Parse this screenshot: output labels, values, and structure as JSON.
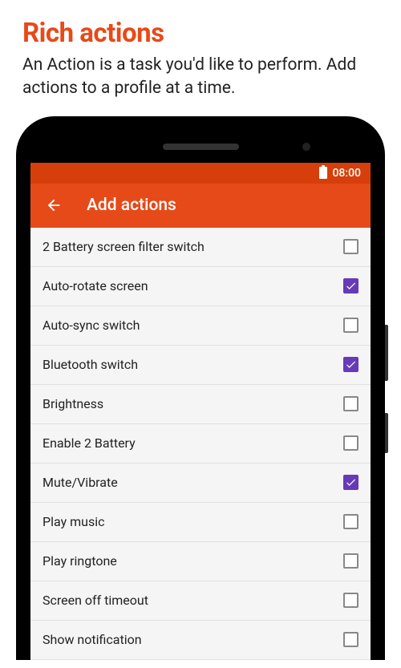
{
  "header": {
    "title": "Rich actions",
    "subtitle": "An Action is a task you'd like to perform. Add actions to a profile at a time."
  },
  "statusBar": {
    "time": "08:00"
  },
  "appBar": {
    "title": "Add actions"
  },
  "actions": [
    {
      "label": "2 Battery screen filter switch",
      "checked": false
    },
    {
      "label": "Auto-rotate screen",
      "checked": true
    },
    {
      "label": "Auto-sync switch",
      "checked": false
    },
    {
      "label": "Bluetooth switch",
      "checked": true
    },
    {
      "label": "Brightness",
      "checked": false
    },
    {
      "label": "Enable 2 Battery",
      "checked": false
    },
    {
      "label": "Mute/Vibrate",
      "checked": true
    },
    {
      "label": "Play music",
      "checked": false
    },
    {
      "label": "Play ringtone",
      "checked": false
    },
    {
      "label": "Screen off timeout",
      "checked": false
    },
    {
      "label": "Show notification",
      "checked": false
    }
  ],
  "colors": {
    "accent": "#e64a19",
    "statusBar": "#d63f0c",
    "checkboxChecked": "#673ab7"
  }
}
